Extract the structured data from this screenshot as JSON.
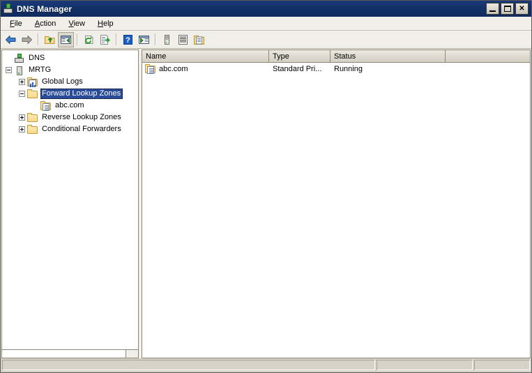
{
  "window": {
    "title": "DNS Manager",
    "title_icon": "dns-server-icon",
    "controls": {
      "minimize": "_",
      "maximize": "□",
      "close": "✕"
    }
  },
  "menubar": {
    "items": [
      {
        "label": "File",
        "accel": "F",
        "name": "menu-file"
      },
      {
        "label": "Action",
        "accel": "A",
        "name": "menu-action"
      },
      {
        "label": "View",
        "accel": "V",
        "name": "menu-view"
      },
      {
        "label": "Help",
        "accel": "H",
        "name": "menu-help"
      }
    ]
  },
  "toolbar": {
    "buttons": [
      {
        "name": "back-button",
        "icon": "back-arrow-icon",
        "tooltip": "Back"
      },
      {
        "name": "forward-button",
        "icon": "forward-arrow-icon",
        "tooltip": "Forward"
      },
      {
        "name": "up-one-level-button",
        "icon": "folder-up-icon",
        "tooltip": "Up One Level"
      },
      {
        "name": "show-hide-tree-button",
        "icon": "show-hide-console-tree-icon",
        "tooltip": "Show/Hide Console Tree",
        "pressed": true
      },
      {
        "name": "refresh-button",
        "icon": "refresh-icon",
        "tooltip": "Refresh"
      },
      {
        "name": "export-list-button",
        "icon": "export-list-icon",
        "tooltip": "Export List"
      },
      {
        "name": "help-button",
        "icon": "help-question-icon",
        "tooltip": "Help"
      },
      {
        "name": "show-properties-button",
        "icon": "properties-window-icon",
        "tooltip": "Properties"
      },
      {
        "name": "new-server-button",
        "icon": "server-icon",
        "tooltip": "New Server"
      },
      {
        "name": "list-view-button",
        "icon": "list-lines-icon",
        "tooltip": "List"
      },
      {
        "name": "new-zone-button",
        "icon": "new-zone-icon",
        "tooltip": "New Zone"
      }
    ]
  },
  "tree": {
    "nodes": [
      {
        "name": "tree-node-dns",
        "label": "DNS",
        "icon": "dns-root-icon",
        "indent": 0,
        "expander": "none",
        "selected": false
      },
      {
        "name": "tree-node-mrtg",
        "label": "MRTG",
        "icon": "server-icon",
        "indent": 1,
        "expander": "minus",
        "selected": false
      },
      {
        "name": "tree-node-global-logs",
        "label": "Global Logs",
        "icon": "log-folder-icon",
        "indent": 2,
        "expander": "plus",
        "selected": false
      },
      {
        "name": "tree-node-forward-lookup-zones",
        "label": "Forward Lookup Zones",
        "icon": "folder-icon",
        "indent": 2,
        "expander": "minus",
        "selected": true
      },
      {
        "name": "tree-node-abc-com",
        "label": "abc.com",
        "icon": "zone-icon",
        "indent": 3,
        "expander": "none",
        "selected": false
      },
      {
        "name": "tree-node-reverse-lookup-zones",
        "label": "Reverse Lookup Zones",
        "icon": "folder-icon",
        "indent": 2,
        "expander": "plus",
        "selected": false
      },
      {
        "name": "tree-node-conditional-forwarders",
        "label": "Conditional Forwarders",
        "icon": "folder-icon",
        "indent": 2,
        "expander": "plus",
        "selected": false
      }
    ]
  },
  "listview": {
    "columns": [
      {
        "name": "column-header-name",
        "label": "Name"
      },
      {
        "name": "column-header-type",
        "label": "Type"
      },
      {
        "name": "column-header-status",
        "label": "Status"
      },
      {
        "name": "column-header-blank",
        "label": ""
      }
    ],
    "rows": [
      {
        "name": "abc.com",
        "icon": "zone-icon",
        "type": "Standard Pri...",
        "status": "Running",
        "extra": ""
      }
    ]
  },
  "statusbar": {
    "panes": [
      {
        "name": "status-pane-main",
        "text": ""
      },
      {
        "name": "status-pane-two",
        "text": ""
      },
      {
        "name": "status-pane-three",
        "text": ""
      }
    ]
  },
  "colors": {
    "titlebar": "#14316a",
    "selection": "#2a4d9b",
    "chrome": "#d6d2c8",
    "toolbar": "#f1efe9",
    "pane_border": "#8d8778",
    "folder_fill": "#f6d98c"
  }
}
